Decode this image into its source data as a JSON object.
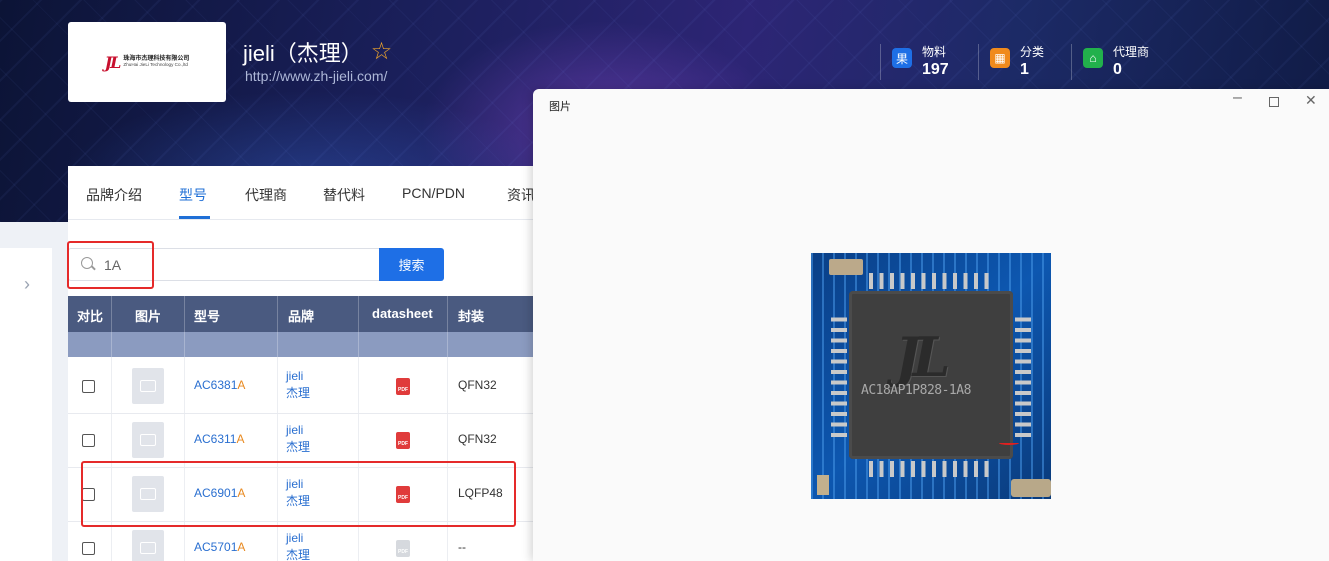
{
  "brand": {
    "logo": {
      "mark": "JL",
      "cn": "珠海市杰理科技有限公司",
      "en": "ZhuHai JieLi Technology Co.,ltd"
    },
    "title": "jieli（杰理）",
    "url": "http://www.zh-jieli.com/",
    "star_icon": "star-outline-icon"
  },
  "stats": [
    {
      "label": "物料",
      "value": "197",
      "icon": "material-icon",
      "color": "#1e6fe6"
    },
    {
      "label": "分类",
      "value": "1",
      "icon": "category-icon",
      "color": "#f08a1c"
    },
    {
      "label": "代理商",
      "value": "0",
      "icon": "store-icon",
      "color": "#22b14c"
    }
  ],
  "tabs": [
    "品牌介绍",
    "型号",
    "代理商",
    "替代料",
    "PCN/PDN",
    "资讯"
  ],
  "active_tab": "型号",
  "search": {
    "value": "1A",
    "button": "搜索"
  },
  "table": {
    "headers": [
      "对比",
      "图片",
      "型号",
      "品牌",
      "datasheet",
      "封装"
    ],
    "rows": [
      {
        "model_prefix": "AC6381",
        "model_hl": "A",
        "brand_en": "jieli",
        "brand_cn": "杰理",
        "package": "QFN32",
        "pdf": true
      },
      {
        "model_prefix": "AC6311",
        "model_hl": "A",
        "brand_en": "jieli",
        "brand_cn": "杰理",
        "package": "QFN32",
        "pdf": true
      },
      {
        "model_prefix": "AC6901",
        "model_hl": "A",
        "brand_en": "jieli",
        "brand_cn": "杰理",
        "package": "LQFP48",
        "pdf": true
      },
      {
        "model_prefix": "AC5701",
        "model_hl": "A",
        "brand_en": "jieli",
        "brand_cn": "杰理",
        "package": "--",
        "pdf": false
      }
    ]
  },
  "viewer": {
    "title": "图片",
    "chip_logo": "JL",
    "chip_marking": "AC18AP1P828-1A8"
  },
  "colors": {
    "accent": "#1e6fe6",
    "highlight": "#e8891f",
    "annotation": "#e52a2a"
  }
}
